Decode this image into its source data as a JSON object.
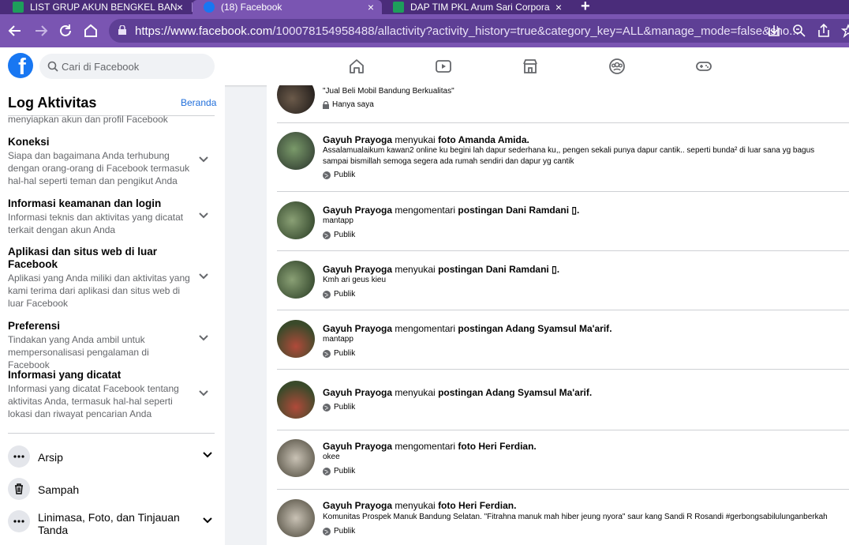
{
  "browser": {
    "tabs": [
      {
        "title": "LIST GRUP AKUN BENGKEL BAN",
        "icon": "sheets-icon",
        "active": false
      },
      {
        "title": "(18) Facebook",
        "icon": "facebook-icon",
        "active": true
      },
      {
        "title": "DAP TIM PKL Arum Sari Corpora",
        "icon": "sheets-icon",
        "active": false
      }
    ],
    "url_domain": "https://www.facebook.com",
    "url_path": "/100078154958488/allactivity?activity_history=true&category_key=ALL&manage_mode=false&sho..."
  },
  "header": {
    "logo": "f",
    "search_placeholder": "Cari di Facebook",
    "nav_icons": [
      "home-icon",
      "watch-icon",
      "marketplace-icon",
      "groups-icon",
      "gaming-icon"
    ]
  },
  "sidebar": {
    "title": "Log Aktivitas",
    "link": "Beranda",
    "cut_text": "menyiapkan akun dan profil Facebook",
    "items": [
      {
        "heading": "Koneksi",
        "desc": "Siapa dan bagaimana Anda terhubung dengan orang-orang di Facebook termasuk hal-hal seperti teman dan pengikut Anda"
      },
      {
        "heading": "Informasi keamanan dan login",
        "desc": "Informasi teknis dan aktivitas yang dicatat terkait dengan akun Anda"
      },
      {
        "heading": "Aplikasi dan situs web di luar Facebook",
        "desc": "Aplikasi yang Anda miliki dan aktivitas yang kami terima dari aplikasi dan situs web di luar Facebook"
      },
      {
        "heading": "Preferensi",
        "desc": "Tindakan yang Anda ambil untuk mempersonalisasi pengalaman di Facebook"
      },
      {
        "heading": "Informasi yang dicatat",
        "desc": "Informasi yang dicatat Facebook tentang aktivitas Anda, termasuk hal-hal seperti lokasi dan riwayat pencarian Anda"
      }
    ],
    "archive": "Arsip",
    "trash": "Sampah",
    "timeline": "Linimasa, Foto, dan Tinjauan Tanda"
  },
  "feed": {
    "entries": [
      {
        "actor": "",
        "action": "",
        "target": "",
        "snippet": "\"Jual Beli Mobil Bandung Berkualitas\"",
        "audience": "Hanya saya",
        "audience_icon": "lock-icon"
      },
      {
        "actor": "Gayuh Prayoga",
        "action": " menyukai ",
        "target": "foto Amanda Amida",
        "snippet": "Assalamualaikum kawan2 online ku  begini lah dapur sederhana ku,, pengen sekali punya dapur cantik.. seperti bunda² di luar sana yg bagus",
        "snippet2": "sampai  bismillah semoga segera ada rumah sendiri dan dapur yg cantik ",
        "audience": "Publik",
        "audience_icon": "globe-icon"
      },
      {
        "actor": "Gayuh Prayoga",
        "action": " mengomentari ",
        "target": "postingan Dani Ramdani ▯",
        "snippet": "mantapp",
        "audience": "Publik",
        "audience_icon": "globe-icon"
      },
      {
        "actor": "Gayuh Prayoga",
        "action": " menyukai ",
        "target": "postingan Dani Ramdani ▯",
        "snippet": "Kmh ari geus kieu",
        "audience": "Publik",
        "audience_icon": "globe-icon"
      },
      {
        "actor": "Gayuh Prayoga",
        "action": " mengomentari ",
        "target": "postingan Adang Syamsul Ma'arif",
        "snippet": "mantapp",
        "audience": "Publik",
        "audience_icon": "globe-icon"
      },
      {
        "actor": "Gayuh Prayoga",
        "action": " menyukai ",
        "target": "postingan Adang Syamsul Ma'arif",
        "snippet": "",
        "audience": "Publik",
        "audience_icon": "globe-icon"
      },
      {
        "actor": "Gayuh Prayoga",
        "action": " mengomentari ",
        "target": "foto Heri Ferdian",
        "snippet": "okee",
        "audience": "Publik",
        "audience_icon": "globe-icon"
      },
      {
        "actor": "Gayuh Prayoga",
        "action": " menyukai ",
        "target": "foto Heri Ferdian",
        "snippet": "Komunitas Prospek Manuk Bandung Selatan. \"Fitrahna manuk mah hiber jeung nyora\" saur kang Sandi R Rosandi #gerbongsabilulunganberkah",
        "audience": "Publik",
        "audience_icon": "globe-icon"
      }
    ]
  },
  "colors": {
    "facebook_blue": "#1877f2",
    "browser_purple": "#7a55b2",
    "link_blue": "#216fdb"
  }
}
